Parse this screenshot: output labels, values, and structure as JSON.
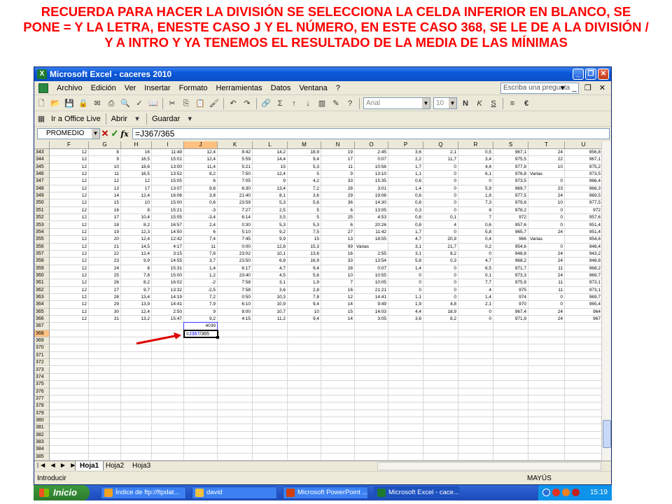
{
  "slide": {
    "title": "RECUERDA PARA HACER LA DIVISIÓN SE SELECCIONA LA CELDA INFERIOR EN BLANCO, SE PONE = Y LA LETRA, ENESTE CASO J Y EL NÚMERO, EN ESTE CASO 368, SE LE DE A LA DIVISIÓN / Y A INTRO Y YA TENEMOS EL RESULTADO DE LA MEDIA DE LAS MÍNIMAS"
  },
  "window": {
    "title": "Microsoft Excel - caceres 2010",
    "menu": [
      "Archivo",
      "Edición",
      "Ver",
      "Insertar",
      "Formato",
      "Herramientas",
      "Datos",
      "Ventana",
      "?"
    ],
    "help_placeholder": "Escriba una pregunta",
    "font_name": "Arial",
    "font_size": "10",
    "format_buttons": [
      "N",
      "K",
      "S"
    ],
    "currency_symbol": "€",
    "office_live": "Ir a Office Live",
    "open_label": "Abrir",
    "save_label": "Guardar"
  },
  "formula_bar": {
    "name_box": "PROMEDIO",
    "formula": "=J367/365"
  },
  "grid": {
    "columns": [
      "F",
      "G",
      "H",
      "I",
      "J",
      "K",
      "L",
      "M",
      "N",
      "O",
      "P",
      "Q",
      "R",
      "S",
      "T",
      "U"
    ],
    "active_column": "J",
    "rows": [
      {
        "n": "343",
        "c": [
          "12",
          "8",
          "16",
          "11:49",
          "12,4",
          "8:42",
          "14,2",
          "18,9",
          "19",
          "2:45",
          "3,6",
          "2,1",
          "0,5",
          "967,1",
          "24",
          "956,8"
        ]
      },
      {
        "n": "344",
        "c": [
          "12",
          "9",
          "16,5",
          "15:01",
          "12,4",
          "5:59",
          "14,4",
          "9,4",
          "17",
          "0:07",
          "2,2",
          "11,7",
          "3,4",
          "975,5",
          "22",
          "967,1"
        ]
      },
      {
        "n": "345",
        "c": [
          "12",
          "10",
          "18,6",
          "13:00",
          "11,4",
          "5:21",
          "15",
          "5,3",
          "11",
          "10:56",
          "1,7",
          "0",
          "4,4",
          "977,8",
          "10",
          "975,2"
        ]
      },
      {
        "n": "346",
        "c": [
          "12",
          "11",
          "16,5",
          "13:52",
          "8,2",
          "7:50",
          "12,4",
          "5",
          "9",
          "13:10",
          "1,1",
          "0",
          "6,1",
          "976,8",
          "Varias",
          "973,5"
        ]
      },
      {
        "n": "347",
        "c": [
          "12",
          "12",
          "12",
          "15:05",
          "6",
          "7:05",
          "9",
          "4,2",
          "33",
          "15:35",
          "0,6",
          "0",
          "0",
          "973,5",
          "0",
          "966,4"
        ]
      },
      {
        "n": "348",
        "c": [
          "12",
          "13",
          "17",
          "13:07",
          "9,8",
          "6:30",
          "13,4",
          "7,2",
          "28",
          "3:01",
          "1,4",
          "0",
          "5,9",
          "969,7",
          "23",
          "966,3"
        ]
      },
      {
        "n": "349",
        "c": [
          "12",
          "14",
          "12,4",
          "16:06",
          "3,8",
          "21:40",
          "8,1",
          "3,6",
          "29",
          "19:08",
          "0,6",
          "0",
          "1,8",
          "977,5",
          "24",
          "969,5"
        ]
      },
      {
        "n": "350",
        "c": [
          "12",
          "15",
          "10",
          "15:00",
          "0,6",
          "23:59",
          "5,3",
          "5,6",
          "36",
          "14:30",
          "0,8",
          "0",
          "7,3",
          "979,8",
          "10",
          "977,5"
        ]
      },
      {
        "n": "351",
        "c": [
          "12",
          "16",
          "8",
          "15:21",
          "-3",
          "7:27",
          "2,5",
          "5",
          "6",
          "13:05",
          "0,3",
          "0",
          "8",
          "978,2",
          "0",
          "972"
        ]
      },
      {
        "n": "352",
        "c": [
          "12",
          "17",
          "10,4",
          "15:05",
          "-3,4",
          "6:14",
          "3,5",
          "5",
          "25",
          "4:53",
          "0,8",
          "0,1",
          "7",
          "972",
          "0",
          "957,6"
        ]
      },
      {
        "n": "353",
        "c": [
          "12",
          "18",
          "8,2",
          "16:57",
          "2,4",
          "0:30",
          "5,3",
          "5,3",
          "6",
          "20:26",
          "0,8",
          "4",
          "0,6",
          "957,6",
          "0",
          "951,4"
        ]
      },
      {
        "n": "354",
        "c": [
          "12",
          "19",
          "12,3",
          "14:50",
          "6",
          "5:10",
          "9,2",
          "7,5",
          "27",
          "11:42",
          "1,7",
          "0",
          "5,8",
          "965,7",
          "24",
          "951,4"
        ]
      },
      {
        "n": "355",
        "c": [
          "12",
          "20",
          "12,4",
          "12:42",
          "7,4",
          "7:45",
          "9,9",
          "15",
          "13",
          "18:55",
          "4,7",
          "20,9",
          "0,4",
          "966",
          "Varias",
          "954,6"
        ]
      },
      {
        "n": "356",
        "c": [
          "12",
          "21",
          "14,5",
          "4:17",
          "11",
          "0:00",
          "12,8",
          "15,3",
          "99",
          "Varias",
          "3,1",
          "21,7",
          "0,2",
          "954,6",
          "0",
          "948,4"
        ]
      },
      {
        "n": "357",
        "c": [
          "12",
          "22",
          "12,4",
          "3:15",
          "7,8",
          "23:02",
          "10,1",
          "13,6",
          "16",
          "2:55",
          "3,1",
          "8,2",
          "0",
          "948,8",
          "24",
          "943,2"
        ]
      },
      {
        "n": "358",
        "c": [
          "12",
          "23",
          "9,9",
          "14:55",
          "3,7",
          "23:50",
          "6,8",
          "16,9",
          "33",
          "13:54",
          "5,8",
          "0,3",
          "4,7",
          "968,2",
          "24",
          "948,8"
        ]
      },
      {
        "n": "359",
        "c": [
          "12",
          "24",
          "8",
          "15:31",
          "1,4",
          "6:17",
          "4,7",
          "9,4",
          "28",
          "0:07",
          "1,4",
          "0",
          "6,5",
          "971,7",
          "11",
          "968,2"
        ]
      },
      {
        "n": "360",
        "c": [
          "12",
          "25",
          "7,8",
          "15:00",
          "1,2",
          "23:40",
          "4,5",
          "5,6",
          "10",
          "10:55",
          "0",
          "0",
          "0,1",
          "973,3",
          "24",
          "969,7"
        ]
      },
      {
        "n": "361",
        "c": [
          "12",
          "26",
          "8,2",
          "16:02",
          "-2",
          "7:58",
          "3,1",
          "1,9",
          "7",
          "10:05",
          "0",
          "0",
          "7,7",
          "975,9",
          "11",
          "973,1"
        ]
      },
      {
        "n": "362",
        "c": [
          "12",
          "27",
          "9,7",
          "13:32",
          "-2,5",
          "7:58",
          "3,6",
          "2,8",
          "16",
          "21:21",
          "0",
          "0",
          "4",
          "975",
          "11",
          "973,1"
        ]
      },
      {
        "n": "363",
        "c": [
          "12",
          "28",
          "13,4",
          "14:19",
          "7,2",
          "0:50",
          "10,3",
          "7,8",
          "12",
          "14:41",
          "1,1",
          "0",
          "1,4",
          "974",
          "0",
          "969,7"
        ]
      },
      {
        "n": "364",
        "c": [
          "12",
          "29",
          "13,9",
          "14:41",
          "7,9",
          "6:10",
          "10,9",
          "9,4",
          "14",
          "9:49",
          "1,9",
          "4,8",
          "2,1",
          "970",
          "0",
          "965,4"
        ]
      },
      {
        "n": "365",
        "c": [
          "12",
          "30",
          "12,4",
          "2:50",
          "9",
          "8:00",
          "10,7",
          "10",
          "15",
          "14:03",
          "4,4",
          "18,9",
          "0",
          "967,4",
          "24",
          "964"
        ]
      },
      {
        "n": "366",
        "c": [
          "12",
          "31",
          "13,2",
          "15:47",
          "9,2",
          "4:15",
          "11,2",
          "9,4",
          "14",
          "3:05",
          "3,6",
          "8,2",
          "0",
          "971,9",
          "24",
          "967"
        ]
      },
      {
        "n": "367",
        "c": [
          "",
          "",
          "",
          "",
          "4039",
          "",
          "",
          "",
          "",
          "",
          "",
          "",
          "",
          "",
          "",
          ""
        ]
      },
      {
        "n": "368",
        "c": [
          "",
          "",
          "",
          "",
          "",
          "",
          "",
          "",
          "",
          "",
          "",
          "",
          "",
          "",
          "",
          ""
        ]
      },
      {
        "n": "369",
        "c": []
      },
      {
        "n": "370",
        "c": []
      },
      {
        "n": "371",
        "c": []
      },
      {
        "n": "372",
        "c": []
      },
      {
        "n": "373",
        "c": []
      },
      {
        "n": "374",
        "c": []
      },
      {
        "n": "375",
        "c": []
      },
      {
        "n": "376",
        "c": []
      },
      {
        "n": "377",
        "c": []
      },
      {
        "n": "378",
        "c": []
      },
      {
        "n": "379",
        "c": []
      },
      {
        "n": "380",
        "c": []
      },
      {
        "n": "381",
        "c": []
      },
      {
        "n": "382",
        "c": []
      },
      {
        "n": "383",
        "c": []
      },
      {
        "n": "384",
        "c": []
      },
      {
        "n": "385",
        "c": []
      },
      {
        "n": "386",
        "c": []
      }
    ],
    "editing_cell": {
      "row": "368",
      "text_prefix": "=",
      "ref": "J367",
      "text_suffix": "/365"
    }
  },
  "sheets": {
    "tabs": [
      "Hoja1",
      "Hoja2",
      "Hoja3"
    ],
    "active": "Hoja1"
  },
  "status": {
    "mode": "Introducir",
    "caps": "MAYÚS"
  },
  "taskbar": {
    "start_label": "Inicio",
    "tasks": [
      {
        "label": "Índice de ftp://ftpdat...",
        "color": "#f0a020"
      },
      {
        "label": "david",
        "color": "#f0c040"
      },
      {
        "label": "Microsoft PowerPoint ...",
        "color": "#d04010"
      },
      {
        "label": "Microsoft Excel - cace...",
        "color": "#1d7a2f"
      }
    ],
    "clock": "15:19"
  },
  "colors": {
    "title_red": "#ff0000",
    "reference_blue": "#3a3aff",
    "arrow_red": "#e00000"
  }
}
